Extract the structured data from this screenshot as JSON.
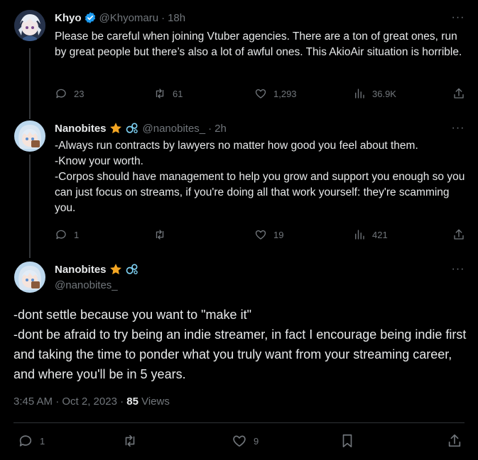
{
  "tweets": [
    {
      "name": "Khyo",
      "handle": "@Khyomaru",
      "time": "18h",
      "text": "Please be careful when joining Vtuber agencies. There are a ton of great ones, run by great people but there’s also a lot of awful ones. This AkioAir situation is horrible.",
      "replies": "23",
      "reposts": "61",
      "likes": "1,293",
      "views": "36.9K"
    },
    {
      "name": "Nanobites",
      "handle": "@nanobites_",
      "time": "2h",
      "text": "-Always run contracts by lawyers no matter how good you feel about them.\n-Know your worth.\n-Corpos should have management to help you grow and support you enough so you can just focus on streams, if you're doing all that work yourself: they're scamming you.",
      "replies": "1",
      "reposts": "",
      "likes": "19",
      "views": "421"
    }
  ],
  "main": {
    "name": "Nanobites",
    "handle": "@nanobites_",
    "text": "-dont settle because you want to \"make it\"\n-dont be afraid to try being an indie streamer, in fact I encourage being indie first and taking the time to ponder what you truly want from your streaming career, and where you'll be in 5 years.",
    "timestamp": "3:45 AM · Oct 2, 2023 · ",
    "views_count": "85",
    "views_label": " Views",
    "replies": "1",
    "reposts": "",
    "likes": "9"
  },
  "separator": "·",
  "more_glyph": "···",
  "colors": {
    "background": "#000000",
    "text": "#e7e9ea",
    "muted": "#71767b",
    "verified": "#1d9bf0",
    "star": "#f4a623",
    "bubble": "#7fd3f5"
  },
  "icons": [
    "verified-icon",
    "star-icon",
    "bubbles-icon",
    "reply-icon",
    "repost-icon",
    "like-icon",
    "views-icon",
    "bookmark-icon",
    "share-icon",
    "more-icon"
  ]
}
